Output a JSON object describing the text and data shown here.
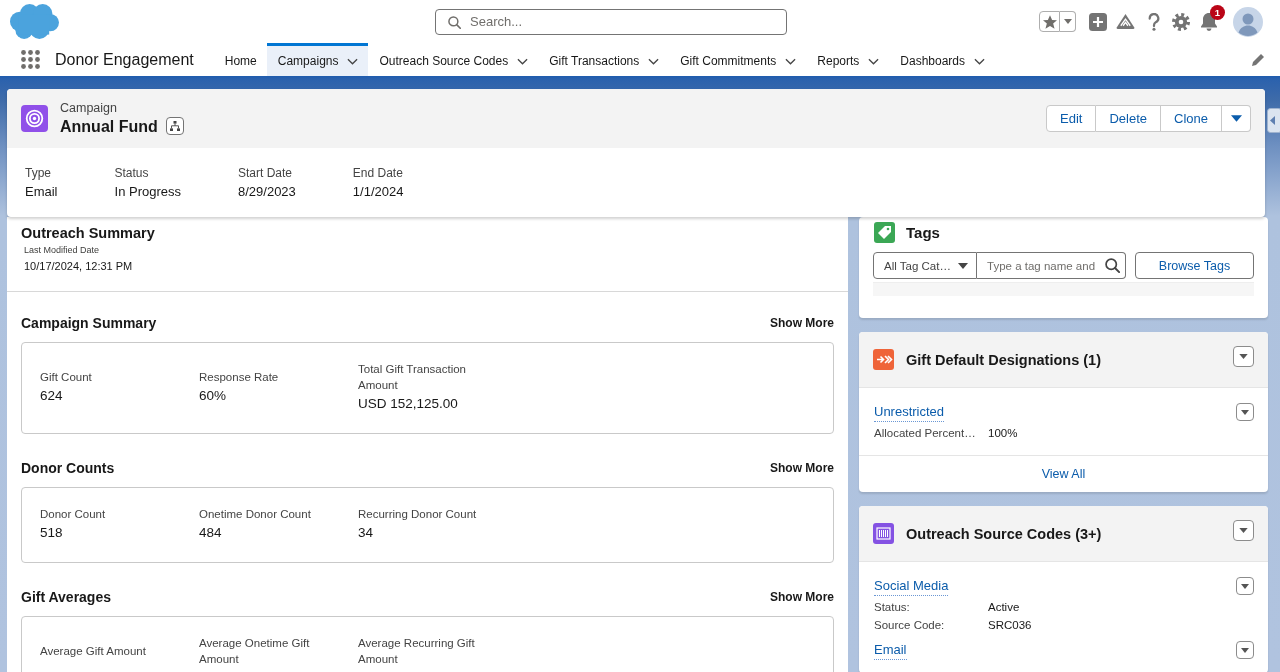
{
  "header": {
    "search": {
      "placeholder": "Search..."
    },
    "notifications": "1"
  },
  "nav": {
    "app_name": "Donor Engagement",
    "tabs": [
      {
        "label": "Home",
        "selected": false,
        "menu": false
      },
      {
        "label": "Campaigns",
        "selected": true,
        "menu": true
      },
      {
        "label": "Outreach Source Codes",
        "selected": false,
        "menu": true
      },
      {
        "label": "Gift Transactions",
        "selected": false,
        "menu": true
      },
      {
        "label": "Gift Commitments",
        "selected": false,
        "menu": true
      },
      {
        "label": "Reports",
        "selected": false,
        "menu": true
      },
      {
        "label": "Dashboards",
        "selected": false,
        "menu": true
      }
    ]
  },
  "record": {
    "object_label": "Campaign",
    "title": "Annual Fund",
    "actions": [
      "Edit",
      "Delete",
      "Clone"
    ],
    "fields": [
      {
        "label": "Type",
        "value": "Email"
      },
      {
        "label": "Status",
        "value": "In Progress"
      },
      {
        "label": "Start Date",
        "value": "8/29/2023"
      },
      {
        "label": "End Date",
        "value": "1/1/2024"
      }
    ]
  },
  "outreach_summary": {
    "title": "Outreach Summary",
    "last_modified_label": "Last Modified Date",
    "last_modified": "10/17/2024, 12:31 PM"
  },
  "sections": [
    {
      "title": "Campaign Summary",
      "action": "Show More",
      "fields": [
        {
          "label": "Gift Count",
          "value": "624"
        },
        {
          "label": "Response Rate",
          "value": "60%"
        },
        {
          "label": "Total Gift Transaction Amount",
          "value": "USD 152,125.00"
        }
      ]
    },
    {
      "title": "Donor Counts",
      "action": "Show More",
      "fields": [
        {
          "label": "Donor Count",
          "value": "518"
        },
        {
          "label": "Onetime Donor Count",
          "value": "484"
        },
        {
          "label": "Recurring Donor Count",
          "value": "34"
        }
      ]
    },
    {
      "title": "Gift Averages",
      "action": "Show More",
      "fields": [
        {
          "label": "Average Gift Amount"
        },
        {
          "label": "Average Onetime Gift Amount"
        },
        {
          "label": "Average Recurring Gift Amount"
        }
      ]
    }
  ],
  "tags": {
    "title": "Tags",
    "category": "All Tag Cat…",
    "placeholder": "Type a tag name and",
    "button": "Browse Tags"
  },
  "related_lists": [
    {
      "kind": "designations",
      "title": "Gift Default Designations (1)",
      "records": [
        {
          "name": "Unrestricted",
          "fields": [
            {
              "label": "Allocated Percent…",
              "value": "100%"
            }
          ]
        }
      ],
      "footer": "View All"
    },
    {
      "kind": "source_codes",
      "title": "Outreach Source Codes (3+)",
      "records": [
        {
          "name": "Social Media",
          "fields": [
            {
              "label": "Status:",
              "value": "Active"
            },
            {
              "label": "Source Code:",
              "value": "SRC036"
            }
          ]
        },
        {
          "name": "Email"
        }
      ]
    }
  ]
}
